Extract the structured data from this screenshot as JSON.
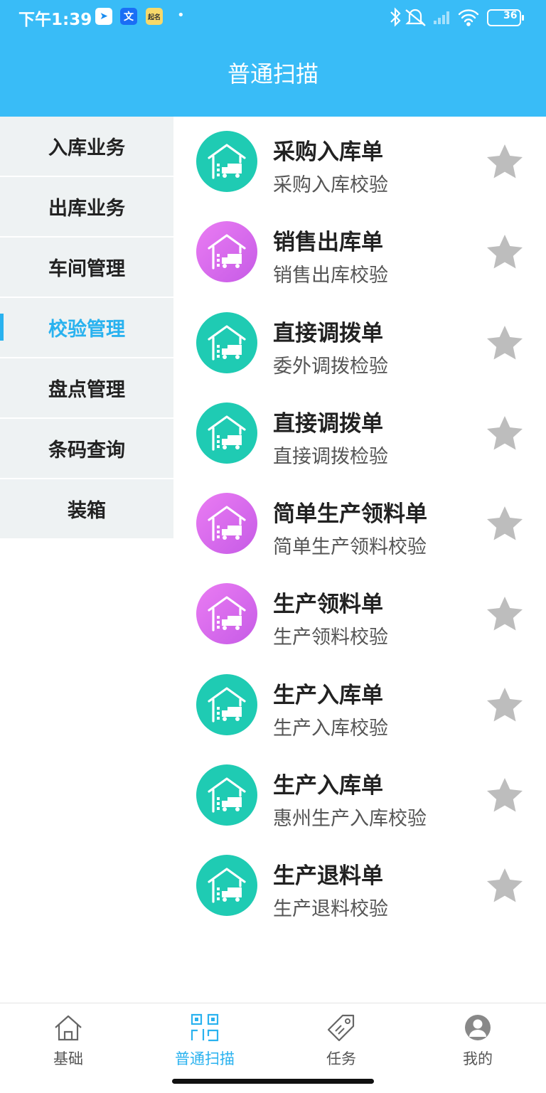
{
  "status_bar": {
    "time": "下午1:39",
    "app_icons": [
      "paper-plane-app-icon",
      "translate-app-icon",
      "badge-app-icon"
    ],
    "app_icon_glyphs": [
      "➤",
      "文",
      "起名"
    ],
    "dot": "•",
    "battery": "36"
  },
  "header": {
    "title": "普通扫描"
  },
  "sidebar": {
    "items": [
      {
        "label": "入库业务"
      },
      {
        "label": "出库业务"
      },
      {
        "label": "车间管理"
      },
      {
        "label": "校验管理",
        "active": true
      },
      {
        "label": "盘点管理"
      },
      {
        "label": "条码查询"
      },
      {
        "label": "装箱"
      }
    ]
  },
  "list": {
    "items": [
      {
        "title": "采购入库单",
        "subtitle": "采购入库校验",
        "icon_color": "teal"
      },
      {
        "title": "销售出库单",
        "subtitle": "销售出库校验",
        "icon_color": "purple"
      },
      {
        "title": "直接调拨单",
        "subtitle": "委外调拨检验",
        "icon_color": "teal"
      },
      {
        "title": "直接调拨单",
        "subtitle": "直接调拨检验",
        "icon_color": "teal"
      },
      {
        "title": "简单生产领料单",
        "subtitle": "简单生产领料校验",
        "icon_color": "purple"
      },
      {
        "title": "生产领料单",
        "subtitle": "生产领料校验",
        "icon_color": "purple"
      },
      {
        "title": "生产入库单",
        "subtitle": "生产入库校验",
        "icon_color": "teal"
      },
      {
        "title": "生产入库单",
        "subtitle": "惠州生产入库校验",
        "icon_color": "teal"
      },
      {
        "title": "生产退料单",
        "subtitle": "生产退料校验",
        "icon_color": "teal"
      }
    ]
  },
  "tabbar": {
    "tabs": [
      {
        "label": "基础",
        "icon": "home-icon"
      },
      {
        "label": "普通扫描",
        "icon": "qr-scan-icon",
        "active": true
      },
      {
        "label": "任务",
        "icon": "tag-icon"
      },
      {
        "label": "我的",
        "icon": "user-icon"
      }
    ]
  },
  "colors": {
    "header": "#39bcf7",
    "accent": "#29b2ef",
    "teal": "#1fcbb3",
    "purple": "#d46aeb",
    "star": "#bdbdbd"
  }
}
